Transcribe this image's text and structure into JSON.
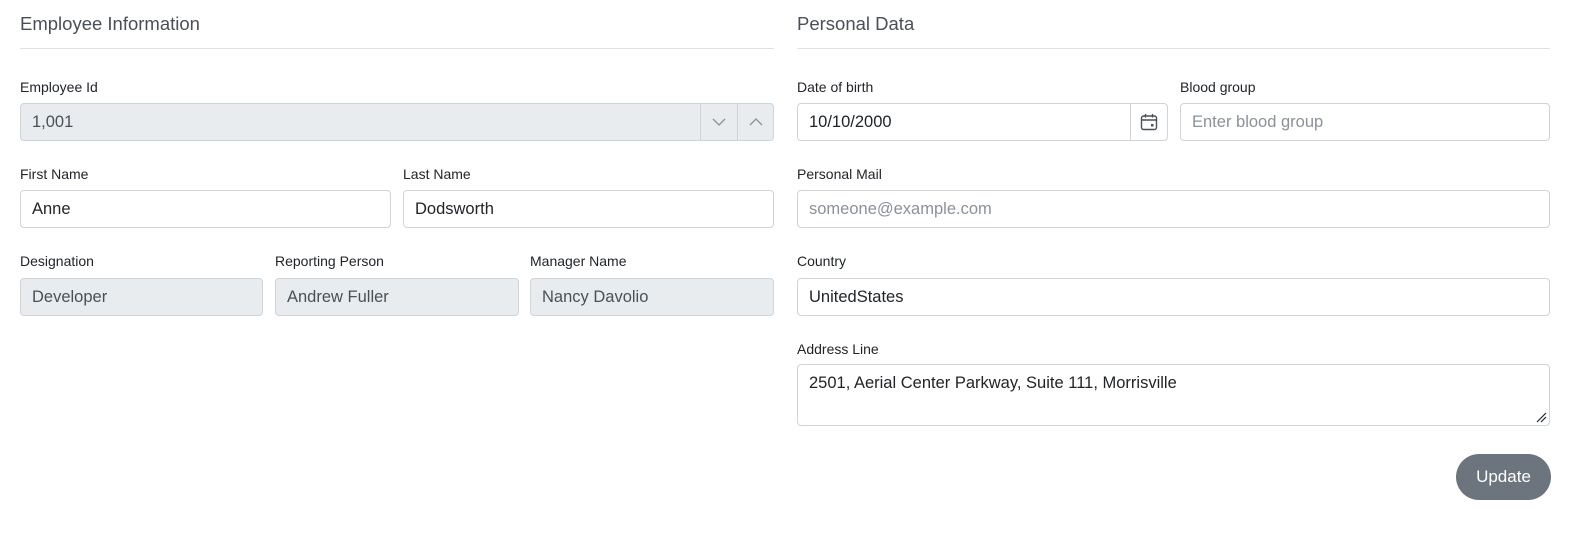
{
  "employee": {
    "title": "Employee Information",
    "employee_id": {
      "label": "Employee Id",
      "value": "1,001"
    },
    "first_name": {
      "label": "First Name",
      "value": "Anne"
    },
    "last_name": {
      "label": "Last Name",
      "value": "Dodsworth"
    },
    "designation": {
      "label": "Designation",
      "value": "Developer"
    },
    "reporting_person": {
      "label": "Reporting Person",
      "value": "Andrew Fuller"
    },
    "manager_name": {
      "label": "Manager Name",
      "value": "Nancy Davolio"
    }
  },
  "personal": {
    "title": "Personal Data",
    "dob": {
      "label": "Date of birth",
      "value": "10/10/2000"
    },
    "blood_group": {
      "label": "Blood group",
      "placeholder": "Enter blood group"
    },
    "mail": {
      "label": "Personal Mail",
      "placeholder": "someone@example.com"
    },
    "country": {
      "label": "Country",
      "value": "UnitedStates"
    },
    "address": {
      "label": "Address Line",
      "value": "2501, Aerial Center Parkway, Suite 111, Morrisville"
    }
  },
  "actions": {
    "update_label": "Update"
  },
  "icons": {
    "spin_down": "chevron-down-icon",
    "spin_up": "chevron-up-icon",
    "calendar": "calendar-icon",
    "resize": "resize-grip-icon"
  },
  "colors": {
    "disabled_bg": "#e9ecef",
    "border": "#ced4da",
    "button_bg": "#6c757d",
    "divider": "#dee2e6"
  }
}
